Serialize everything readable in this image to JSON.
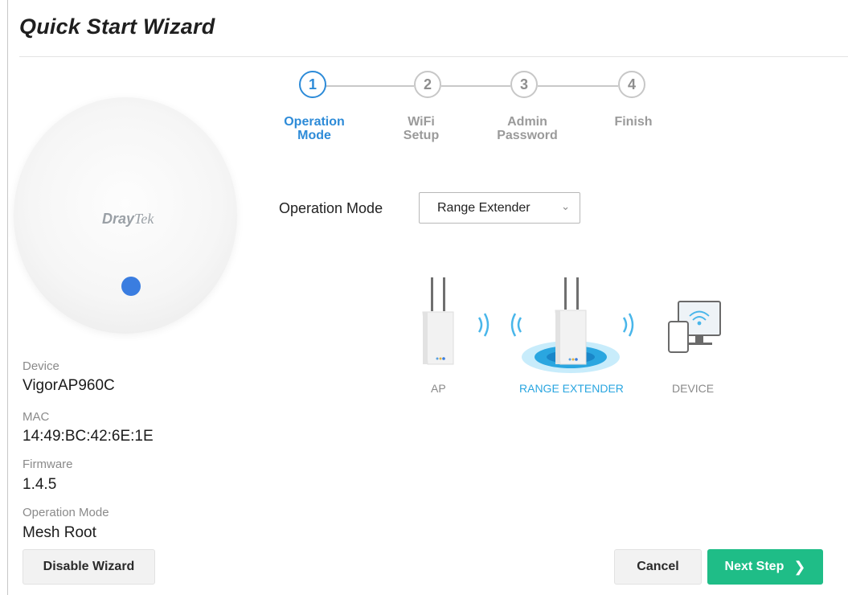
{
  "title": "Quick Start Wizard",
  "device_panel": {
    "logo_left": "Dray",
    "logo_right": "Tek",
    "device_label": "Device",
    "device_value": "VigorAP960C",
    "mac_label": "MAC",
    "mac_value": "14:49:BC:42:6E:1E",
    "firmware_label": "Firmware",
    "firmware_value": "1.4.5",
    "mode_label": "Operation Mode",
    "mode_value": "Mesh Root"
  },
  "steps": [
    {
      "number": "1",
      "line1": "Operation",
      "line2": "Mode",
      "active": true
    },
    {
      "number": "2",
      "line1": "WiFi",
      "line2": "Setup",
      "active": false
    },
    {
      "number": "3",
      "line1": "Admin",
      "line2": "Password",
      "active": false
    },
    {
      "number": "4",
      "line1": "Finish",
      "line2": "",
      "active": false
    }
  ],
  "operation_mode": {
    "label": "Operation Mode",
    "selected": "Range Extender"
  },
  "diagram": {
    "ap_label": "AP",
    "extender_label": "RANGE EXTENDER",
    "device_label": "DEVICE"
  },
  "buttons": {
    "disable": "Disable Wizard",
    "cancel": "Cancel",
    "next": "Next Step"
  },
  "colors": {
    "accent": "#2d8bd8",
    "primary_button": "#1fbd87",
    "led": "#3a7de0"
  }
}
